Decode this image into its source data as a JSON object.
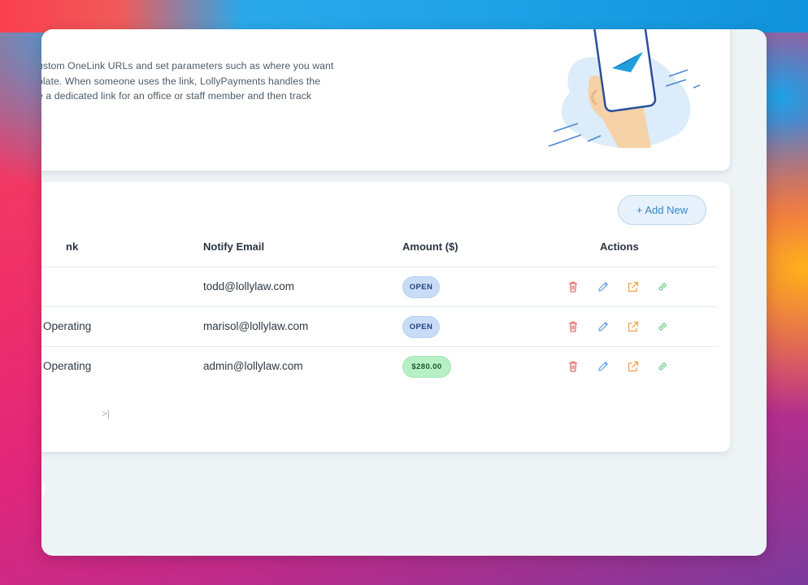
{
  "info": {
    "lines": [
      "ustom OneLink URLs and set parameters such as where you want",
      "plate. When someone uses the link, LollyPayments handles the",
      "e a dedicated link for an office or staff member and then track"
    ]
  },
  "toolbar": {
    "add_new_label": "+ Add New"
  },
  "table": {
    "columns": [
      "nk",
      "Notify Email",
      "Amount ($)",
      "Actions"
    ],
    "rows": [
      {
        "link": "",
        "email": "todd@lollylaw.com",
        "amount": "OPEN",
        "amount_status": "open"
      },
      {
        "link": "Operating",
        "email": "marisol@lollylaw.com",
        "amount": "OPEN",
        "amount_status": "open"
      },
      {
        "link": "Operating",
        "email": "admin@lollylaw.com",
        "amount": "$280.00",
        "amount_status": "paid"
      }
    ]
  },
  "pagination": {
    "last_label": ">|"
  },
  "colors": {
    "delete": "#e0726f",
    "edit": "#6ea7df",
    "open_external": "#f0a04a",
    "copy_link": "#79d08e",
    "badge_open": "#c9dcf7",
    "badge_paid": "#b8f0c6"
  }
}
